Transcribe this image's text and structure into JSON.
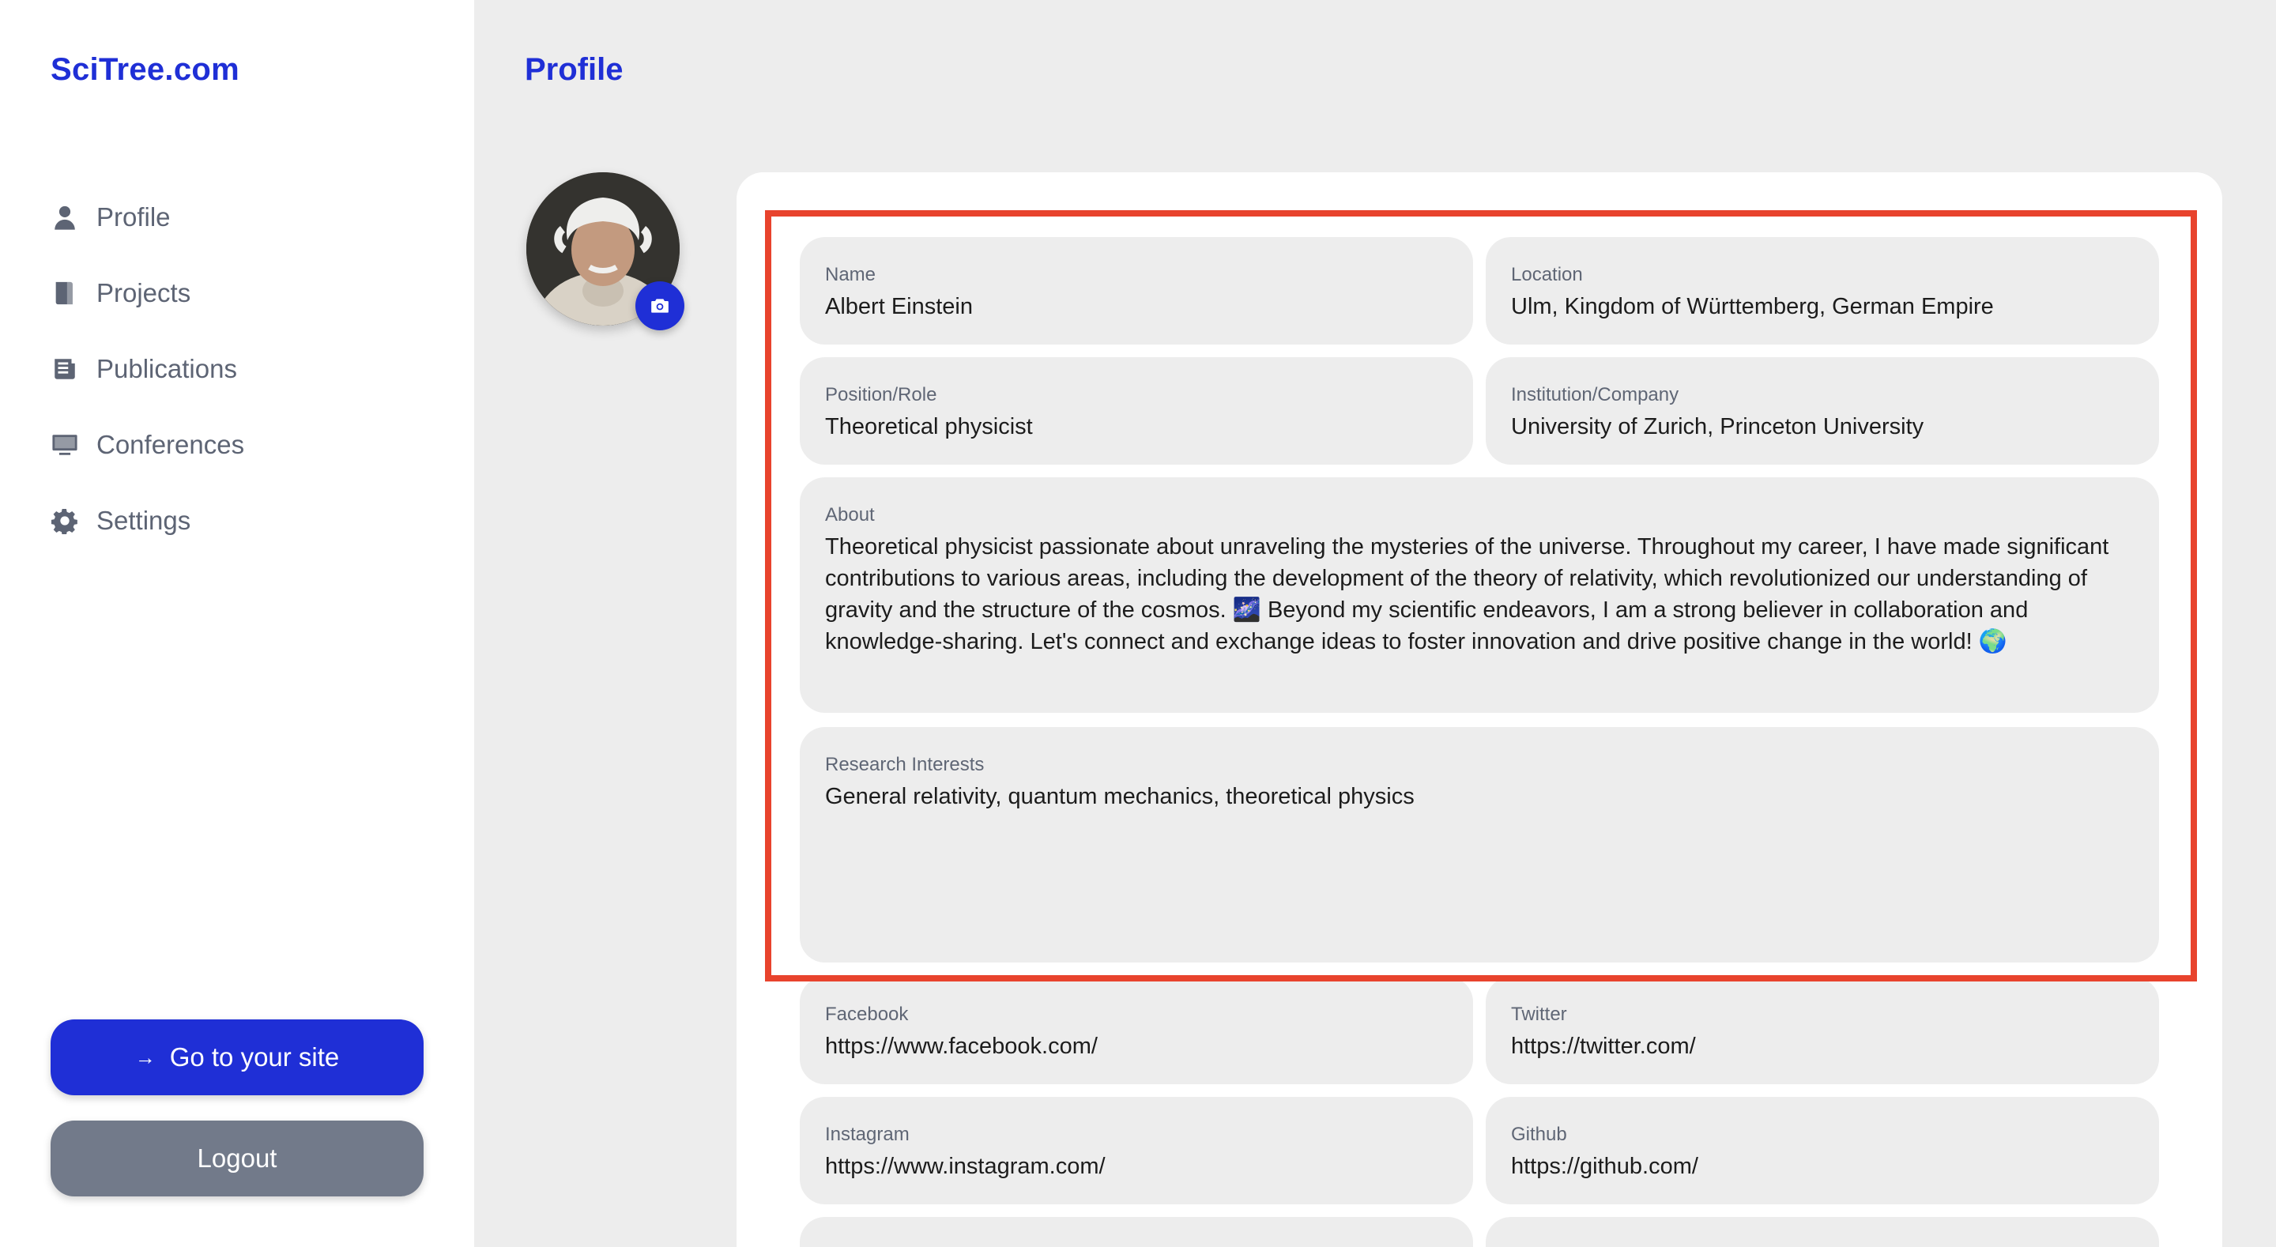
{
  "sidebar": {
    "brand": "SciTree.com",
    "items": [
      {
        "label": "Profile",
        "icon": "user-icon"
      },
      {
        "label": "Projects",
        "icon": "book-icon"
      },
      {
        "label": "Publications",
        "icon": "newspaper-icon"
      },
      {
        "label": "Conferences",
        "icon": "monitor-icon"
      },
      {
        "label": "Settings",
        "icon": "gear-icon"
      }
    ],
    "go_to_site": {
      "arrow": "→",
      "label": "Go to your site"
    },
    "logout": "Logout"
  },
  "main": {
    "title": "Profile",
    "fields": {
      "name": {
        "label": "Name",
        "value": "Albert Einstein"
      },
      "location": {
        "label": "Location",
        "value": "Ulm, Kingdom of Württemberg, German Empire"
      },
      "position": {
        "label": "Position/Role",
        "value": "Theoretical physicist"
      },
      "institution": {
        "label": "Institution/Company",
        "value": "University of Zurich, Princeton University"
      },
      "about": {
        "label": "About",
        "value": "Theoretical physicist passionate about unraveling the mysteries of the universe. Throughout my career, I have made significant contributions to various areas, including the development of the theory of relativity, which revolutionized our understanding of gravity and the structure of the cosmos. 🌌 Beyond my scientific endeavors, I am a strong believer in collaboration and knowledge-sharing. Let's connect and exchange ideas to foster innovation and drive positive change in the world! 🌍"
      },
      "research": {
        "label": "Research Interests",
        "value": "General relativity, quantum mechanics, theoretical physics"
      },
      "facebook": {
        "label": "Facebook",
        "value": "https://www.facebook.com/"
      },
      "twitter": {
        "label": "Twitter",
        "value": "https://twitter.com/"
      },
      "instagram": {
        "label": "Instagram",
        "value": "https://www.instagram.com/"
      },
      "github": {
        "label": "Github",
        "value": "https://github.com/"
      }
    }
  },
  "colors": {
    "accent": "#1f2fd6",
    "highlight": "#e8432d",
    "logout": "#727a8a"
  }
}
